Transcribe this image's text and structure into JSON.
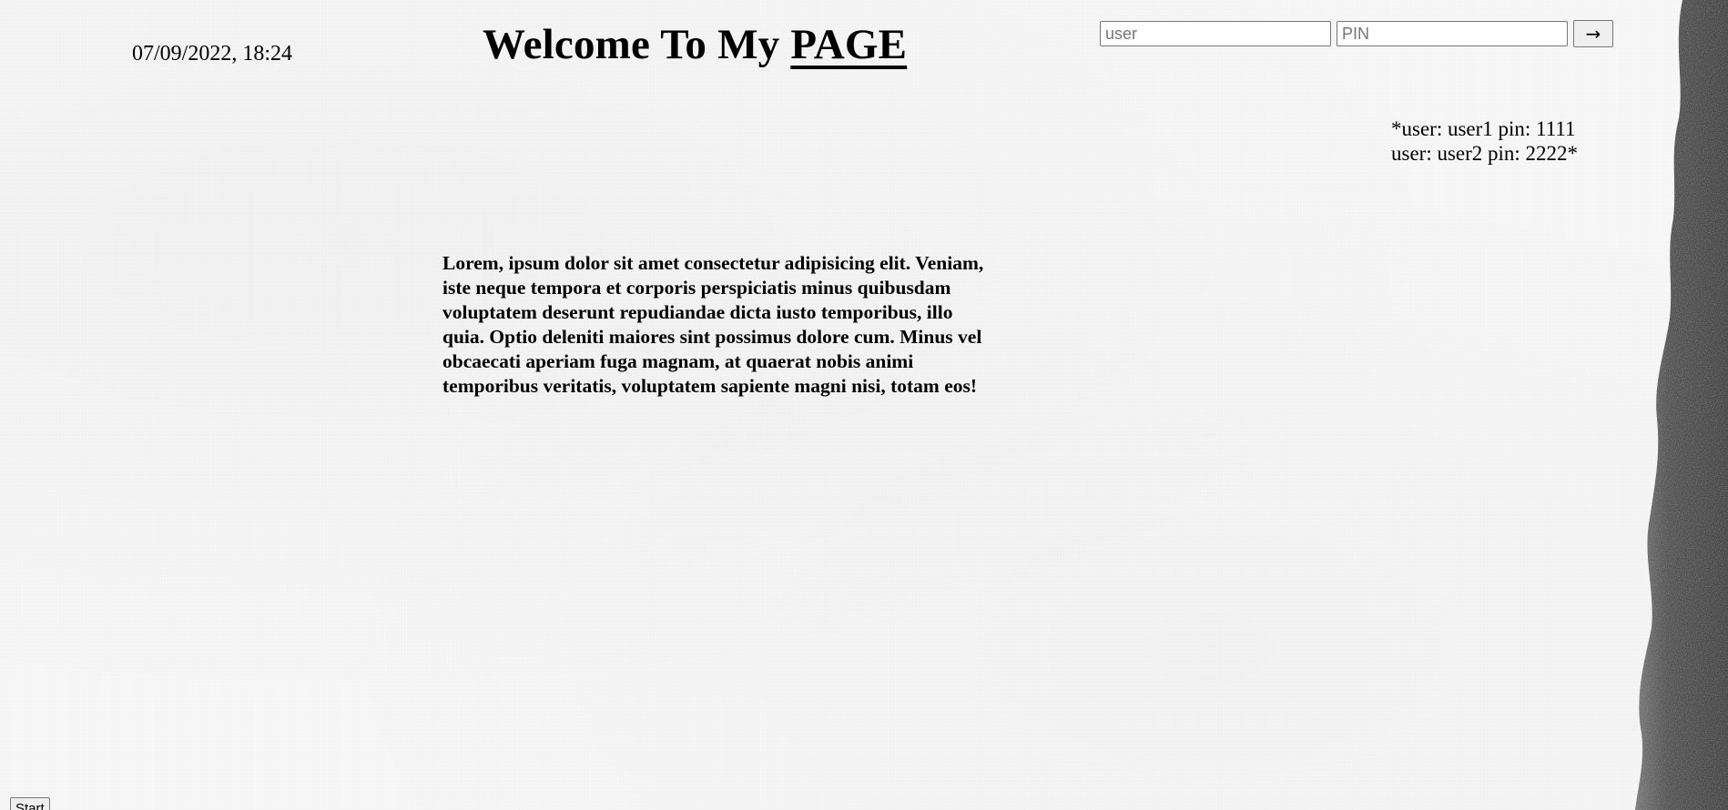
{
  "header": {
    "datetime": "07/09/2022, 18:24",
    "title_prefix": "Welcome To My",
    "title_emphasis": "PAGE"
  },
  "login": {
    "user_placeholder": "user",
    "user_value": "",
    "pin_placeholder": "PIN",
    "pin_value": "",
    "submit_label": "→"
  },
  "credentials_hint": {
    "line1": "*user: user1 pin: 1111",
    "line2": "user: user2 pin: 2222*"
  },
  "main": {
    "paragraph": "Lorem, ipsum dolor sit amet consectetur adipisicing elit. Veniam, iste neque tempora et corporis perspiciatis minus quibusdam voluptatem deserunt repudiandae dicta iusto temporibus, illo quia. Optio deleniti maiores sint possimus dolore cum. Minus vel obcaecati aperiam fuga magnam, at quaerat nobis animi temporibus veritatis, voluptatem sapiente magni nisi, totam eos!"
  },
  "footer": {
    "start_label": "Start"
  },
  "colors": {
    "text": "#000000",
    "background": "#f7f7f7",
    "rock": "#3a3a3a"
  }
}
